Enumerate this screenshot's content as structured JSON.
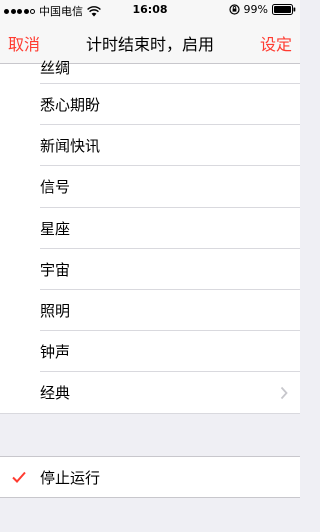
{
  "status_bar": {
    "carrier": "中国电信",
    "time": "16:08",
    "battery": "99%"
  },
  "nav": {
    "cancel_label": "取消",
    "title": "计时结束时，启用",
    "set_label": "设定"
  },
  "sounds": [
    {
      "label": "丝绸"
    },
    {
      "label": "悉心期盼"
    },
    {
      "label": "新闻快讯"
    },
    {
      "label": "信号"
    },
    {
      "label": "星座"
    },
    {
      "label": "宇宙"
    },
    {
      "label": "照明"
    },
    {
      "label": "钟声"
    },
    {
      "label": "经典"
    }
  ],
  "stop": {
    "label": "停止运行",
    "selected": true
  },
  "accent_color": "#ff3b30"
}
